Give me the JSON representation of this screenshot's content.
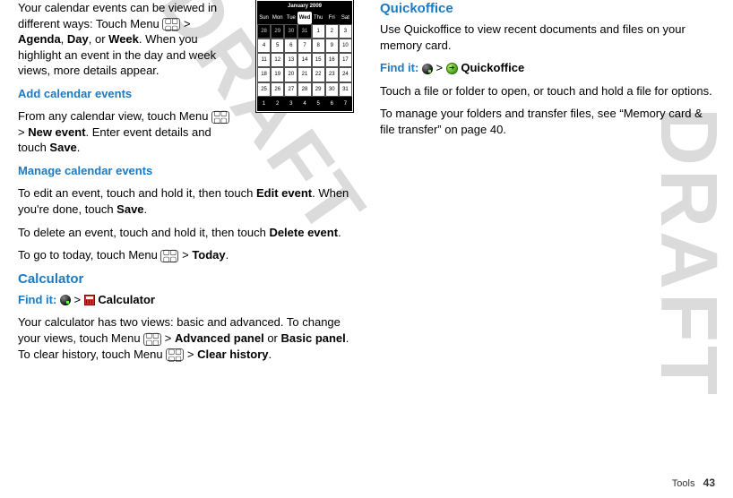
{
  "watermark": "DRAFT",
  "left": {
    "p1a": "Your calendar events can be viewed in different ways: Touch Menu ",
    "p1b": " > ",
    "p1c": "Agenda",
    "p1d": ", ",
    "p1e": "Day",
    "p1f": ", or ",
    "p1g": "Week",
    "p1h": ". When you highlight an event in the day and week views, more details appear.",
    "h1": "Add calendar events",
    "p2a": "From any calendar view, touch Menu ",
    "p2b": " > ",
    "p2c": "New event",
    "p2d": ". Enter event details and touch ",
    "p2e": "Save",
    "p2f": ".",
    "h2": "Manage calendar events",
    "p3a": "To edit an event, touch and hold it, then touch ",
    "p3b": "Edit event",
    "p3c": ". When you're done, touch ",
    "p3d": "Save",
    "p3e": ".",
    "p4a": "To delete an event, touch and hold it, then touch ",
    "p4b": "Delete event",
    "p4c": ".",
    "p5a": "To go to today, touch Menu ",
    "p5b": " > ",
    "p5c": "Today",
    "p5d": ".",
    "h3": "Calculator",
    "find_calc_a": "Find it: ",
    "find_calc_b": " > ",
    "find_calc_c": " Calculator",
    "p6a": "Your calculator has two views: basic and advanced. To change your views, touch Menu ",
    "p6b": " > ",
    "p6c": "Advanced panel",
    "p6d": " or ",
    "p6e": "Basic panel",
    "p6f": ". To clear history, touch Menu ",
    "p6g": " > ",
    "p6h": "Clear history",
    "p6i": "."
  },
  "right": {
    "h1": "Quickoffice",
    "p1": "Use Quickoffice to view recent documents and files on your memory card.",
    "find_a": "Find it: ",
    "find_b": " > ",
    "find_c": " Quickoffice",
    "p2": "Touch a file or folder to open, or touch and hold a file for options.",
    "p3": "To manage your folders and transfer files, see “Memory card & file transfer” on page 40."
  },
  "calendar": {
    "title": "January 2009",
    "days": [
      "Sun",
      "Mon",
      "Tue",
      "Wed",
      "Thu",
      "Fri",
      "Sat"
    ],
    "rows": [
      {
        "cells": [
          {
            "v": "28",
            "in": false
          },
          {
            "v": "29",
            "in": false
          },
          {
            "v": "30",
            "in": false
          },
          {
            "v": "31",
            "in": false
          },
          {
            "v": "1",
            "in": true
          },
          {
            "v": "2",
            "in": true
          },
          {
            "v": "3",
            "in": true
          }
        ]
      },
      {
        "cells": [
          {
            "v": "4",
            "in": true
          },
          {
            "v": "5",
            "in": true
          },
          {
            "v": "6",
            "in": true
          },
          {
            "v": "7",
            "in": true
          },
          {
            "v": "8",
            "in": true
          },
          {
            "v": "9",
            "in": true
          },
          {
            "v": "10",
            "in": true
          }
        ]
      },
      {
        "cells": [
          {
            "v": "11",
            "in": true
          },
          {
            "v": "12",
            "in": true
          },
          {
            "v": "13",
            "in": true
          },
          {
            "v": "14",
            "in": true
          },
          {
            "v": "15",
            "in": true
          },
          {
            "v": "16",
            "in": true
          },
          {
            "v": "17",
            "in": true
          }
        ]
      },
      {
        "cells": [
          {
            "v": "18",
            "in": true
          },
          {
            "v": "19",
            "in": true
          },
          {
            "v": "20",
            "in": true
          },
          {
            "v": "21",
            "in": true
          },
          {
            "v": "22",
            "in": true
          },
          {
            "v": "23",
            "in": true
          },
          {
            "v": "24",
            "in": true
          }
        ]
      },
      {
        "cells": [
          {
            "v": "25",
            "in": true
          },
          {
            "v": "26",
            "in": true
          },
          {
            "v": "27",
            "in": true
          },
          {
            "v": "28",
            "in": true
          },
          {
            "v": "29",
            "in": true
          },
          {
            "v": "30",
            "in": true
          },
          {
            "v": "31",
            "in": true
          }
        ]
      }
    ],
    "foot": [
      "1",
      "2",
      "3",
      "4",
      "5",
      "6",
      "7"
    ]
  },
  "footer": {
    "label": "Tools",
    "page": "43"
  }
}
